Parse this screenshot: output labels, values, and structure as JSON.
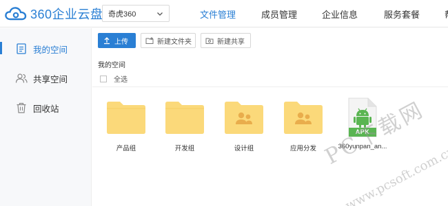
{
  "app": {
    "logo_text": "360企业云盘"
  },
  "header": {
    "org_selector": "奇虎360",
    "nav": [
      {
        "label": "文件管理",
        "active": true
      },
      {
        "label": "成员管理",
        "active": false
      },
      {
        "label": "企业信息",
        "active": false
      },
      {
        "label": "服务套餐",
        "active": false
      },
      {
        "label": "帮",
        "active": false
      }
    ]
  },
  "sidebar": {
    "items": [
      {
        "label": "我的空间",
        "icon": "document-icon",
        "active": true
      },
      {
        "label": "共享空间",
        "icon": "users-icon",
        "active": false
      },
      {
        "label": "回收站",
        "icon": "trash-icon",
        "active": false
      }
    ]
  },
  "toolbar": {
    "upload_label": "上传",
    "new_folder_label": "新建文件夹",
    "new_share_label": "新建共享"
  },
  "breadcrumb": "我的空间",
  "select_all_label": "全选",
  "files": [
    {
      "name": "产品组",
      "type": "folder"
    },
    {
      "name": "开发组",
      "type": "folder"
    },
    {
      "name": "设计组",
      "type": "shared-folder"
    },
    {
      "name": "应用分发",
      "type": "shared-folder"
    },
    {
      "name": "360yunpan_an...",
      "type": "apk",
      "badge": "APK"
    }
  ],
  "watermark": {
    "main": "PC下载网",
    "url": "www.pcsoft.com.cn"
  },
  "colors": {
    "accent": "#2a7fd4",
    "folder": "#fbd97a",
    "apk_green": "#5ab552"
  }
}
